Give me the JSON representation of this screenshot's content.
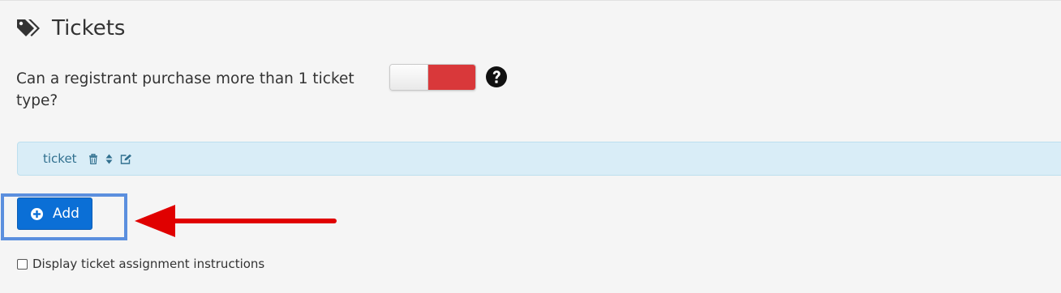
{
  "section": {
    "title": "Tickets",
    "icon": "tags-icon"
  },
  "multi_ticket": {
    "question": "Can a registrant purchase more than 1 ticket type?",
    "toggle_state": "off",
    "help_icon": "question-circle-icon"
  },
  "ticket_list": {
    "items": [
      {
        "name": "ticket",
        "actions": [
          "trash-icon",
          "sort-icon",
          "edit-icon"
        ]
      }
    ]
  },
  "add_button": {
    "label": "Add",
    "icon": "plus-circle-icon"
  },
  "assignment_instructions": {
    "label": "Display ticket assignment instructions",
    "checked": false
  },
  "annotation": {
    "arrow_color": "#e00000",
    "highlight_color": "#5b8fde"
  },
  "colors": {
    "primary": "#0b6fd6",
    "toggle_off": "#d9383a",
    "info_bg": "#d9edf7",
    "info_text": "#31708f"
  }
}
